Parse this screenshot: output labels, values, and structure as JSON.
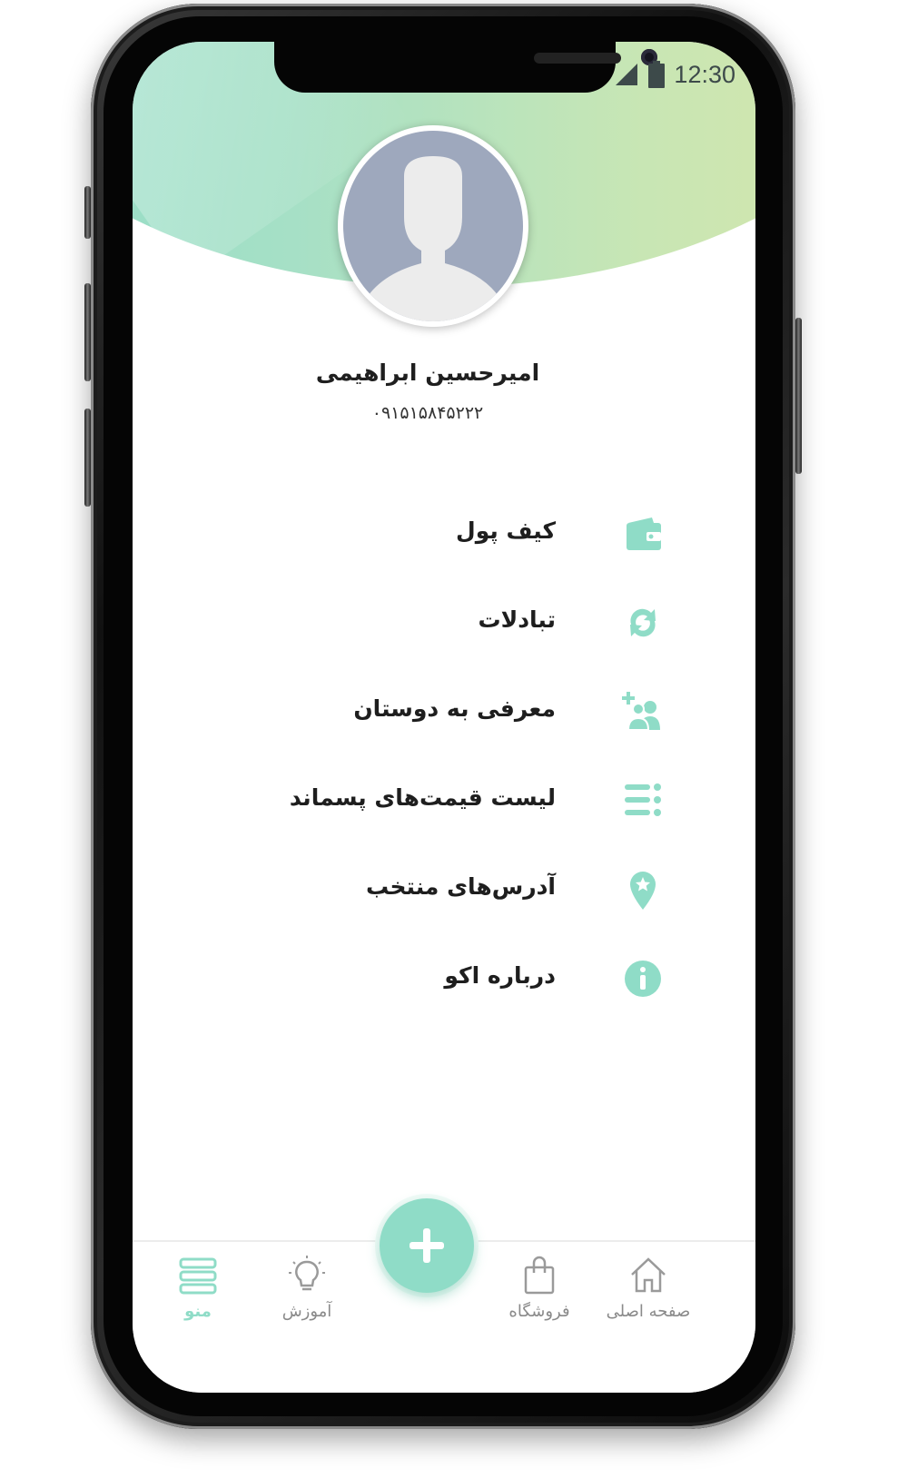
{
  "status_bar": {
    "time": "12:30",
    "signal_icon": "signal-icon",
    "battery_icon": "battery-icon"
  },
  "profile": {
    "name": "امیرحسین ابراهیمی",
    "phone": "۰۹۱۵۱۵۸۴۵۲۲۲"
  },
  "menu": {
    "items": [
      {
        "label": "کیف پول",
        "icon": "wallet-icon"
      },
      {
        "label": "تبادلات",
        "icon": "exchange-icon"
      },
      {
        "label": "معرفی به دوستان",
        "icon": "add-friend-icon"
      },
      {
        "label": "لیست قیمت‌های پسماند",
        "icon": "list-icon"
      },
      {
        "label": "آدرس‌های منتخب",
        "icon": "location-star-icon"
      },
      {
        "label": "درباره اکو",
        "icon": "info-icon"
      }
    ]
  },
  "tabbar": {
    "tabs": [
      {
        "label": "منو",
        "icon": "menu-icon",
        "active": true
      },
      {
        "label": "آموزش",
        "icon": "lightbulb-icon",
        "active": false
      },
      {
        "label": "فروشگاه",
        "icon": "shopping-bag-icon",
        "active": false
      },
      {
        "label": "صفحه اصلی",
        "icon": "home-icon",
        "active": false
      }
    ],
    "add_button_icon": "plus-icon"
  },
  "colors": {
    "accent": "#8fdcc7",
    "header_start": "#8fdcc7",
    "header_end": "#d9e7a9",
    "inactive": "#8a8a8a"
  }
}
